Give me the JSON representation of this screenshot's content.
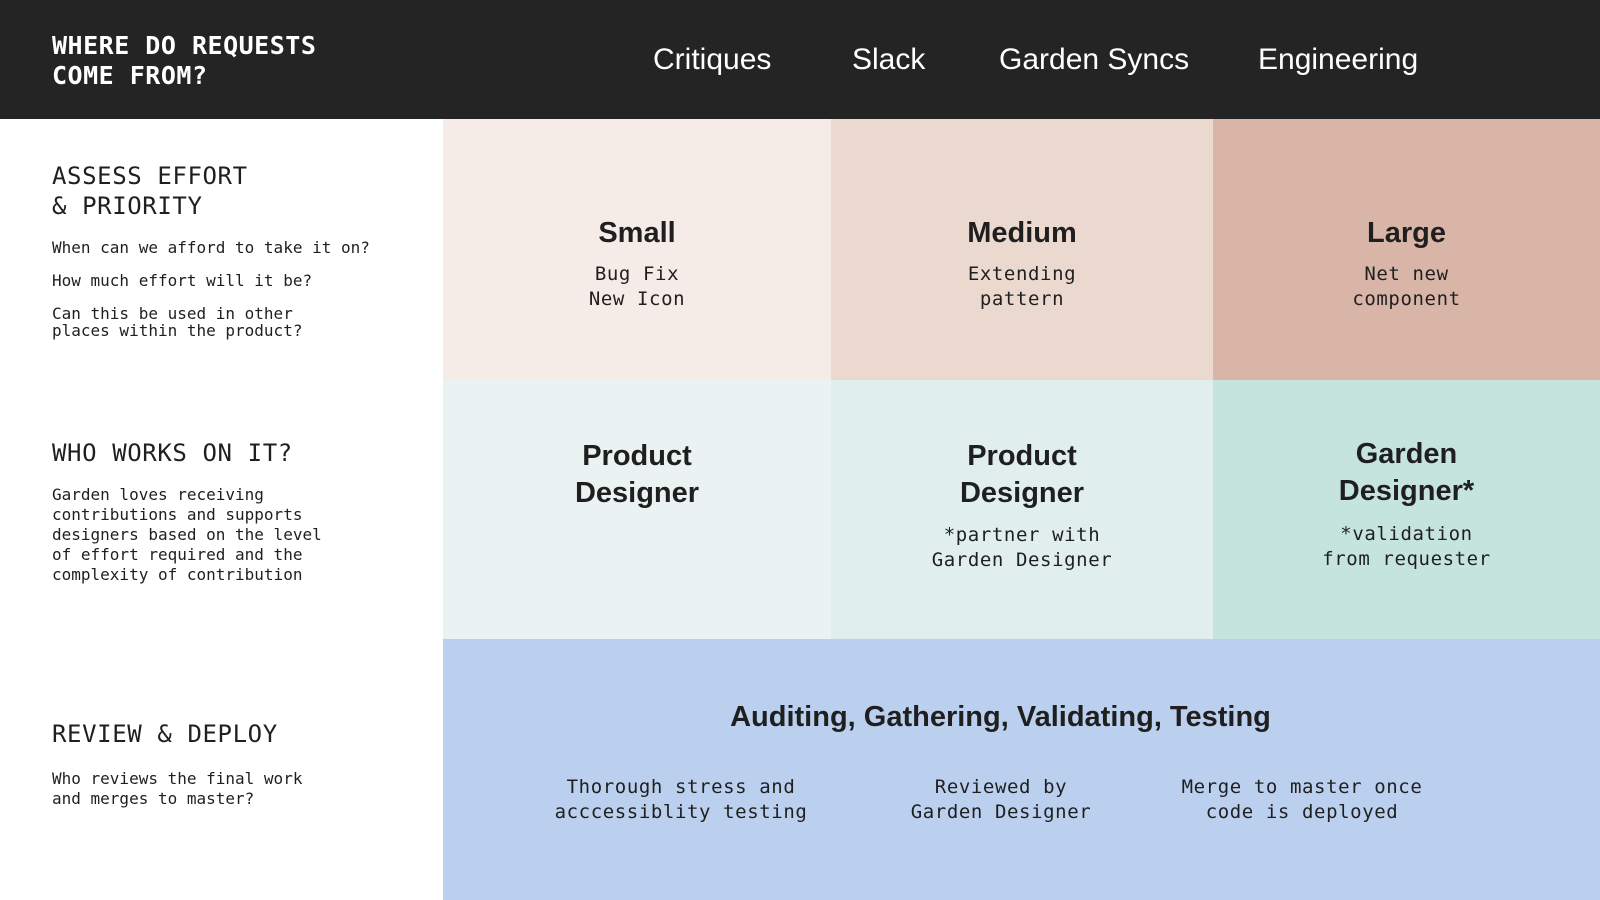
{
  "header": {
    "title": "WHERE DO REQUESTS\nCOME FROM?",
    "sources": [
      "Critiques",
      "Slack",
      "Garden Syncs",
      "Engineering"
    ]
  },
  "rows": {
    "assess": {
      "heading": "ASSESS EFFORT\n& PRIORITY",
      "questions": [
        "When can we afford to take it on?",
        "How much effort will it be?",
        "Can this be used in other\nplaces within the product?"
      ]
    },
    "who": {
      "heading": "WHO WORKS ON IT?",
      "text": "Garden loves receiving\ncontributions and supports\ndesigners based on the level\nof effort required and the\ncomplexity of contribution"
    },
    "review": {
      "heading": "REVIEW & DEPLOY",
      "text": "Who reviews the final work\nand merges to master?"
    }
  },
  "effort": [
    {
      "title": "Small",
      "sub": "Bug Fix\nNew Icon"
    },
    {
      "title": "Medium",
      "sub": "Extending\npattern"
    },
    {
      "title": "Large",
      "sub": "Net new\ncomponent"
    }
  ],
  "workers": [
    {
      "title": "Product\nDesigner",
      "sub": ""
    },
    {
      "title": "Product\nDesigner",
      "sub": "*partner with\nGarden Designer"
    },
    {
      "title": "Garden\nDesigner*",
      "sub": "*validation\nfrom requester"
    }
  ],
  "review_block": {
    "title": "Auditing, Gathering, Validating, Testing",
    "steps": [
      "Thorough stress and\nacccessiblity testing",
      "Reviewed by\nGarden Designer",
      "Merge to master once\ncode is deployed"
    ]
  },
  "colors": {
    "header_bg": "#242424",
    "small": "#f5ebe7",
    "medium": "#ebd9d0",
    "large": "#d8b5a6",
    "worker_1": "#ebf3f2",
    "worker_2": "#e0eeed",
    "worker_3": "#c5e4de",
    "review": "#bbd0ee"
  }
}
